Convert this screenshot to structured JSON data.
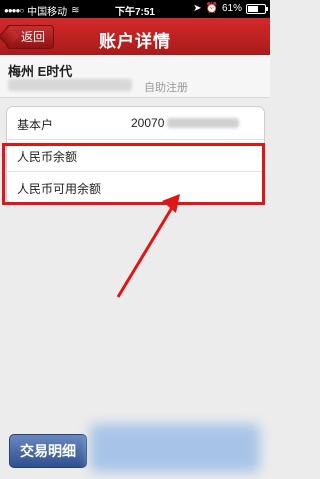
{
  "status_bar": {
    "carrier": "中国移动",
    "time": "下午7:51",
    "battery": "61%",
    "battery_level": 0.61
  },
  "header": {
    "back_label": "返回",
    "title": "账户详情"
  },
  "account": {
    "name": "梅州 E时代",
    "note": "自助注册"
  },
  "details": [
    {
      "label": "基本户",
      "value": "20070"
    },
    {
      "label": "人民币余额",
      "value": ""
    },
    {
      "label": "人民币可用余额",
      "value": ""
    }
  ],
  "actions": {
    "trade_detail_label": "交易明细"
  },
  "colors": {
    "header_red": "#c62525",
    "highlight_red": "#e01515",
    "button_blue": "#3d5d9c"
  }
}
